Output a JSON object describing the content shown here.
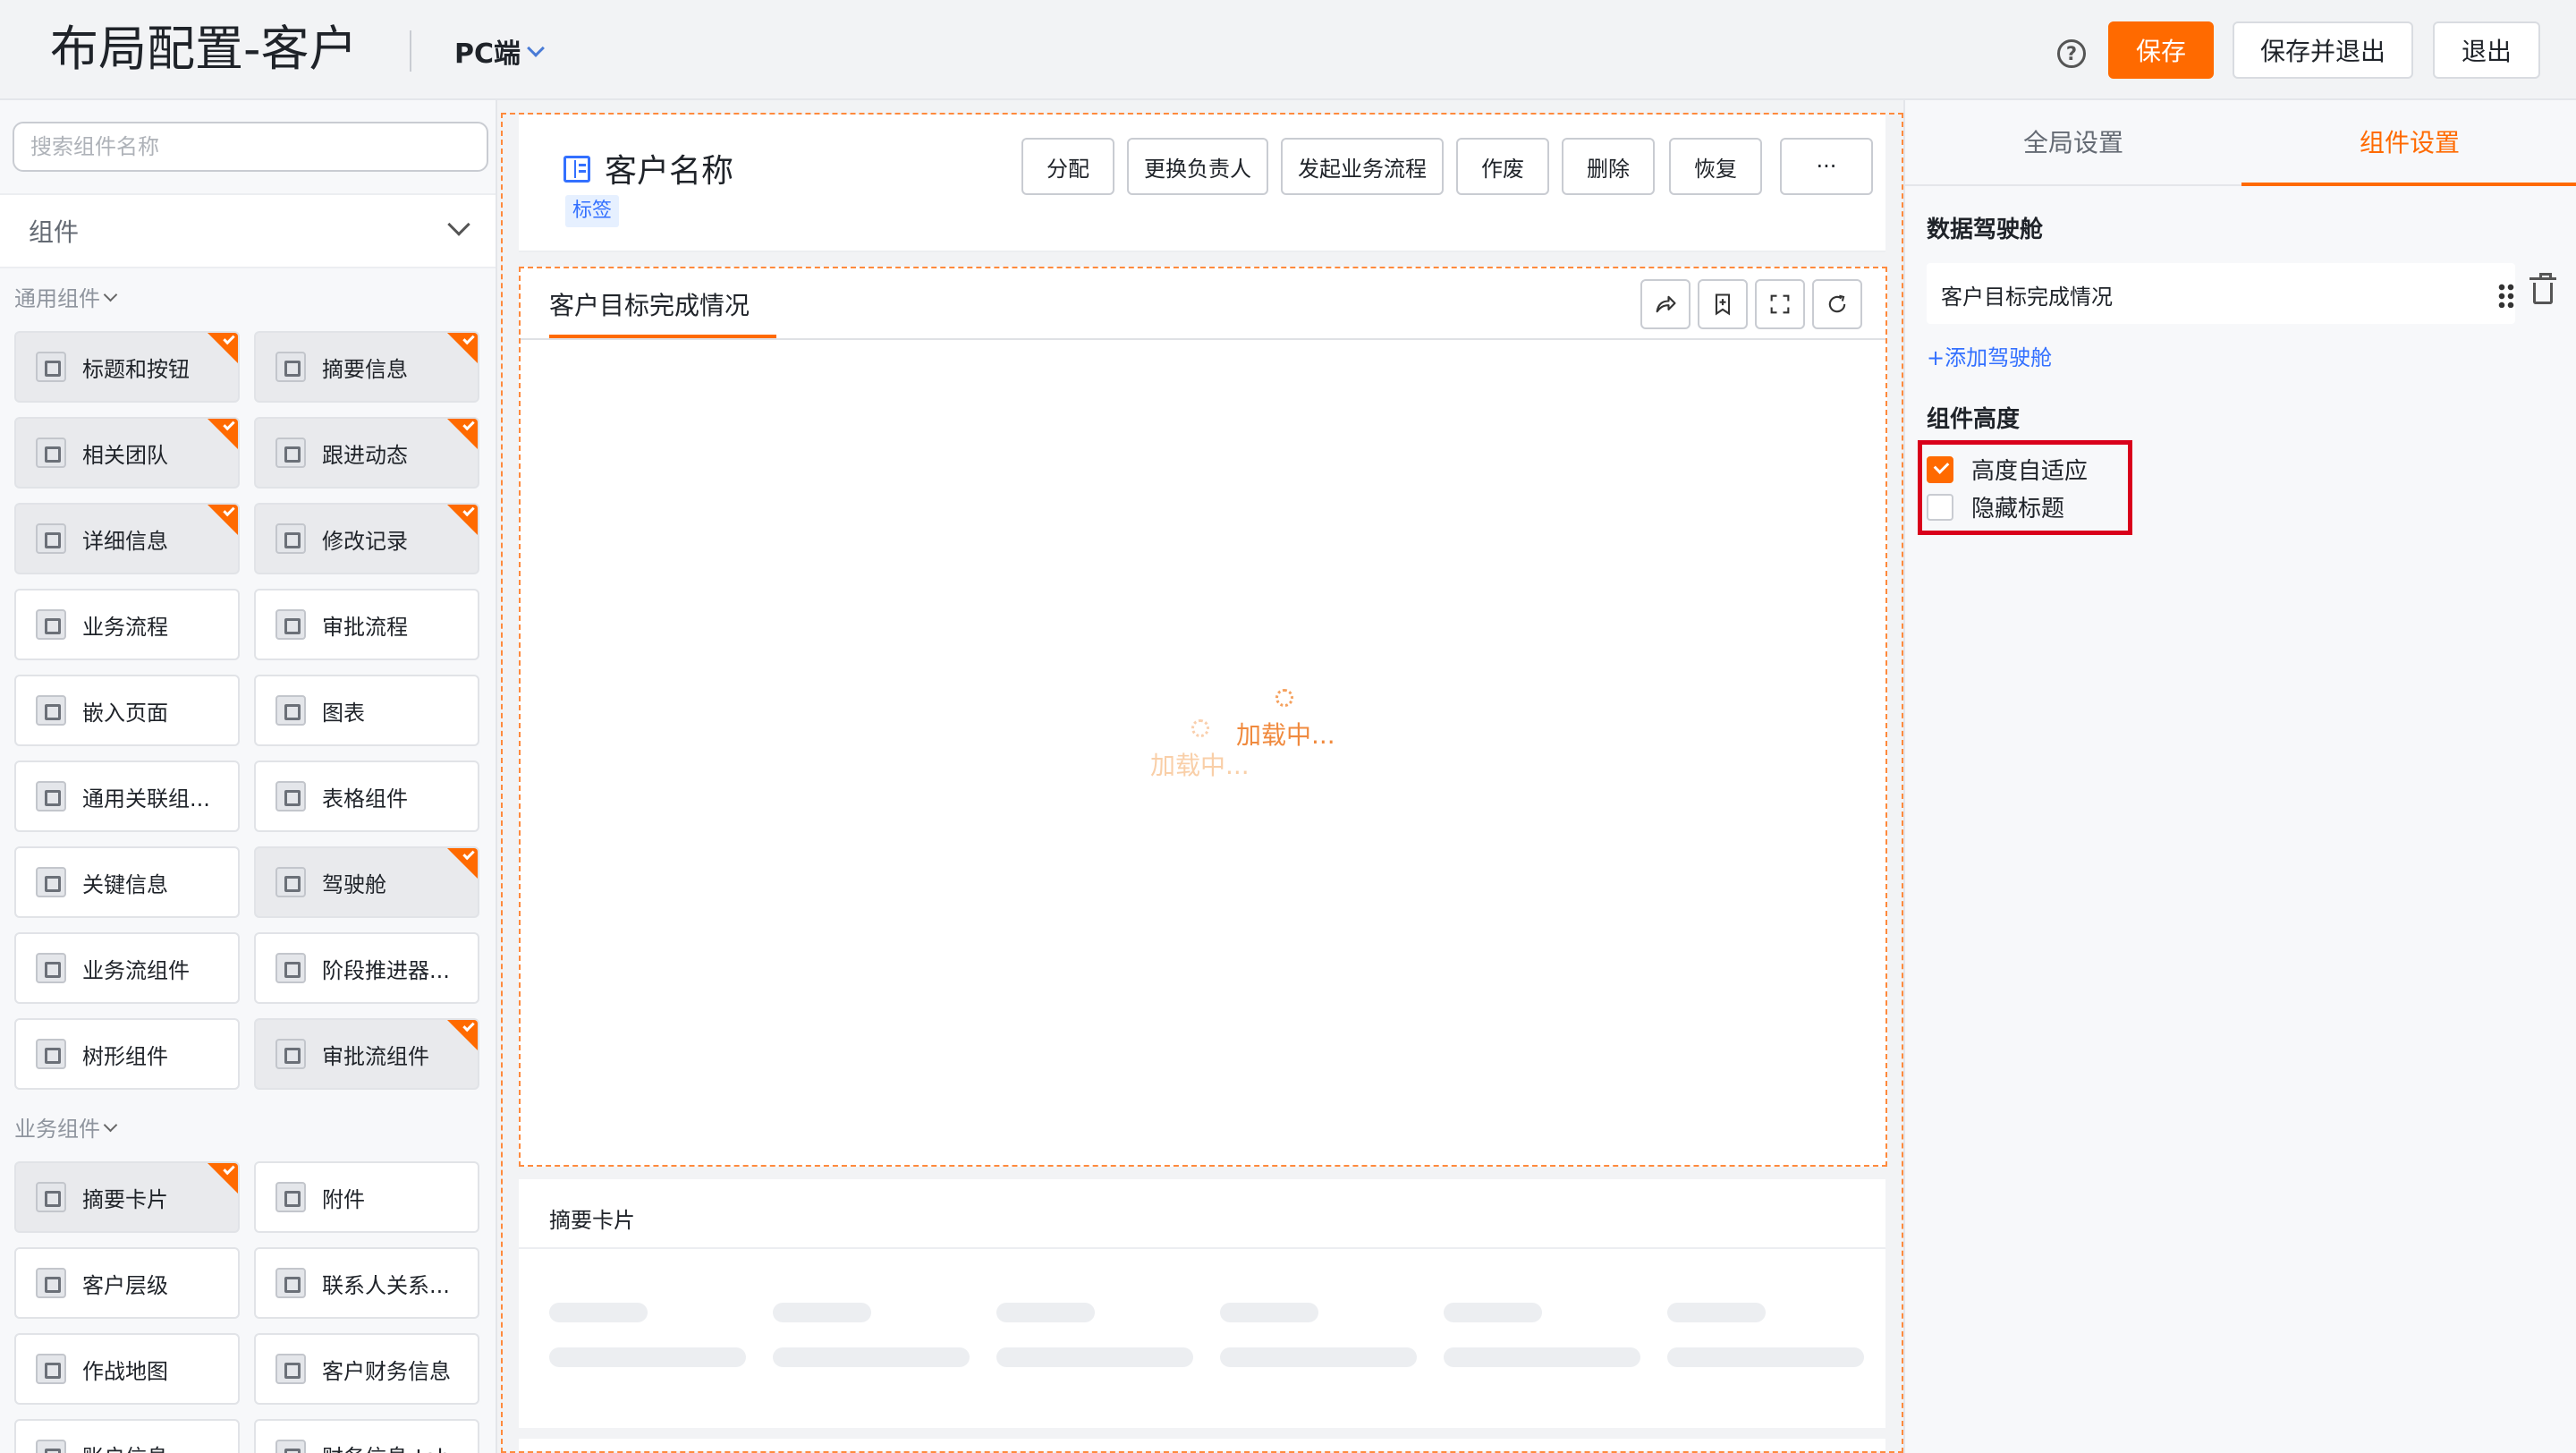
{
  "header": {
    "title": "布局配置-客户",
    "device": "PC端",
    "help_icon": "question-circle-icon",
    "save_label": "保存",
    "save_exit_label": "保存并退出",
    "exit_label": "退出",
    "accent": "#ff6a00"
  },
  "left": {
    "search_placeholder": "搜索组件名称",
    "components_label": "组件",
    "general_group": "通用组件",
    "general_items": [
      {
        "label": "标题和按钮",
        "used": true
      },
      {
        "label": "摘要信息",
        "used": true
      },
      {
        "label": "相关团队",
        "used": true
      },
      {
        "label": "跟进动态",
        "used": true
      },
      {
        "label": "详细信息",
        "used": true
      },
      {
        "label": "修改记录",
        "used": true
      },
      {
        "label": "业务流程",
        "used": false
      },
      {
        "label": "审批流程",
        "used": false
      },
      {
        "label": "嵌入页面",
        "used": false
      },
      {
        "label": "图表",
        "used": false
      },
      {
        "label": "通用关联组...",
        "used": false
      },
      {
        "label": "表格组件",
        "used": false
      },
      {
        "label": "关键信息",
        "used": false
      },
      {
        "label": "驾驶舱",
        "used": true
      },
      {
        "label": "业务流组件",
        "used": false
      },
      {
        "label": "阶段推进器...",
        "used": false
      },
      {
        "label": "树形组件",
        "used": false
      },
      {
        "label": "审批流组件",
        "used": true
      }
    ],
    "business_group": "业务组件",
    "business_items": [
      {
        "label": "摘要卡片",
        "used": true
      },
      {
        "label": "附件",
        "used": false
      },
      {
        "label": "客户层级",
        "used": false
      },
      {
        "label": "联系人关系...",
        "used": false
      },
      {
        "label": "作战地图",
        "used": false
      },
      {
        "label": "客户财务信息",
        "used": false
      },
      {
        "label": "账户信息",
        "used": false
      },
      {
        "label": "财务信息-tab",
        "used": false
      }
    ]
  },
  "canvas": {
    "entity_name": "客户名称",
    "tag": "标签",
    "actions": [
      "分配",
      "更换负责人",
      "发起业务流程",
      "作废",
      "删除",
      "恢复",
      "···"
    ],
    "cockpit_tab": "客户目标完成情况",
    "tool_icons": [
      "share-icon",
      "bookmark-add-icon",
      "fullscreen-icon",
      "refresh-icon"
    ],
    "loading_text": "加载中...",
    "summary_title": "摘要卡片"
  },
  "right": {
    "tab_global": "全局设置",
    "tab_component": "组件设置",
    "cockpit_section": "数据驾驶舱",
    "cockpit_item": "客户目标完成情况",
    "add_cockpit": "+添加驾驶舱",
    "height_section": "组件高度",
    "opt_auto_height": "高度自适应",
    "opt_auto_height_checked": true,
    "opt_hide_title": "隐藏标题",
    "opt_hide_title_checked": false,
    "highlight_color": "#d9001b"
  }
}
